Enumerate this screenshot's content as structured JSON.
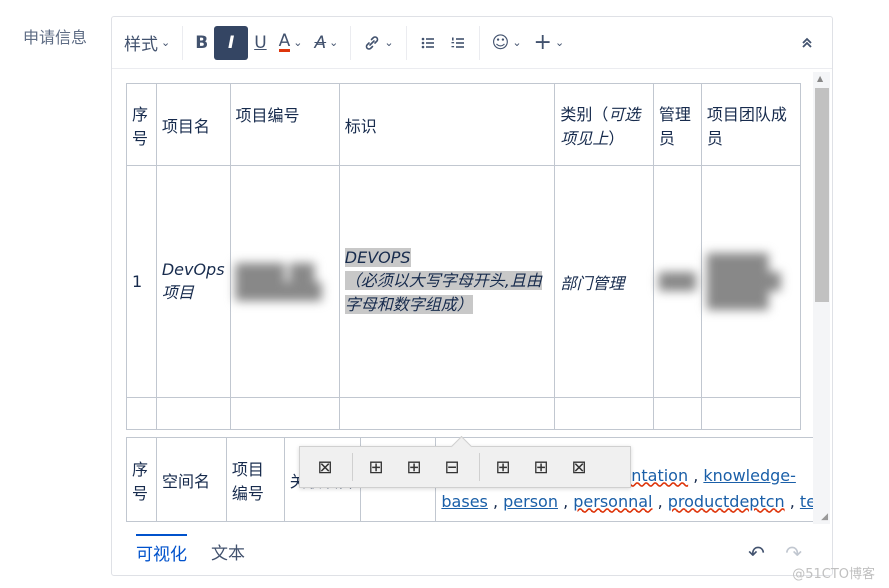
{
  "form": {
    "field_label": "申请信息"
  },
  "toolbar": {
    "style_label": "样式",
    "bold": "B",
    "italic": "I",
    "underline": "U",
    "text_color": "A",
    "clear_format": "A",
    "link": "🔗",
    "bullet_list": "☰",
    "numbered_list": "☷",
    "emoji": "☺",
    "insert": "+",
    "collapse": "⌃"
  },
  "table1": {
    "headers": [
      "序号",
      "项目名",
      "项目编号",
      "标识",
      "类别（可选项见上）",
      "管理员",
      "项目团队成员"
    ],
    "header_cat_plain": "类别（",
    "header_cat_italic": "可选项见上",
    "header_cat_end": "）",
    "row1": {
      "index": "1",
      "name": "DevOps项目",
      "code_blurred": "████ ██ ███████",
      "ident_line1": "DEVOPS",
      "ident_line2": "（必须以大写字母开头,且由字母和数字组成）",
      "category": "部门管理",
      "admin_blurred": "███",
      "members_blurred": "█████ ██████ █████"
    }
  },
  "table2": {
    "headers": [
      "序号",
      "空间名",
      "项目编号",
      "关联项目"
    ],
    "cell_partial": "entation",
    "links": [
      "knowledge-",
      "bases",
      "person",
      "personnal",
      "productdeptcn",
      "tear"
    ]
  },
  "float_toolbar": {
    "delete_table": "⊠",
    "insert_row_above": "⊞",
    "insert_row_below": "⊞",
    "delete_row": "⊟",
    "insert_col_left": "⊞",
    "insert_col_right": "⊞",
    "delete_col": "⊠"
  },
  "bottom": {
    "tab_visual": "可视化",
    "tab_text": "文本",
    "undo": "↶",
    "redo": "↷"
  },
  "watermark": "@51CTO博客"
}
